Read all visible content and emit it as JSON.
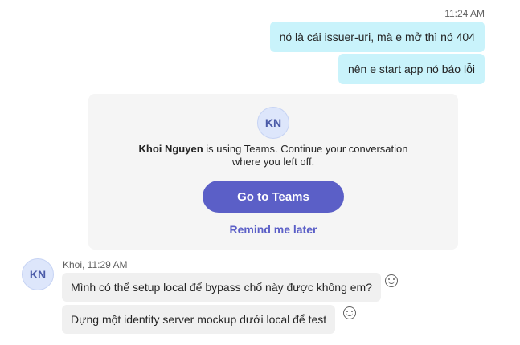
{
  "outgoing": {
    "timestamp": "11:24 AM",
    "messages": [
      "nó là cái issuer-uri, mà e mở thì nó 404",
      "nên e start app nó báo lỗi"
    ]
  },
  "teams_card": {
    "avatar_initials": "KN",
    "user_name": "Khoi Nguyen",
    "message_rest": " is using Teams. Continue your conversation where you left off.",
    "primary_button": "Go to Teams",
    "secondary_link": "Remind me later"
  },
  "incoming": {
    "avatar_initials": "KN",
    "sender_meta": "Khoi, 11:29 AM",
    "messages": [
      "Mình có thể setup local để bypass chổ này được không em?",
      "Dựng một identity server mockup dưới local để test"
    ]
  },
  "icons": {
    "reaction": "smiley-reaction-icon"
  }
}
